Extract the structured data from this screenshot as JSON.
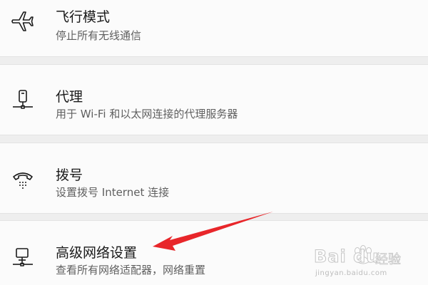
{
  "settings": {
    "items": [
      {
        "title": "飞行模式",
        "description": "停止所有无线通信",
        "icon": "airplane-icon"
      },
      {
        "title": "代理",
        "description": "用于 Wi-Fi 和以太网连接的代理服务器",
        "icon": "proxy-icon"
      },
      {
        "title": "拨号",
        "description": "设置拨号 Internet 连接",
        "icon": "dialup-phone-icon"
      },
      {
        "title": "高级网络设置",
        "description": "查看所有网络适配器，网络重置",
        "icon": "network-pc-icon"
      }
    ]
  },
  "annotation": {
    "arrow_color": "#e8262a"
  },
  "watermark": {
    "brand": "Bai du",
    "sub": "经验",
    "url": "jingyan.baidu.com"
  },
  "colors": {
    "card_background": "#fbfbfb",
    "page_background": "#eeeeee",
    "title_text": "#1a1a1a",
    "description_text": "#5f5f5f"
  }
}
